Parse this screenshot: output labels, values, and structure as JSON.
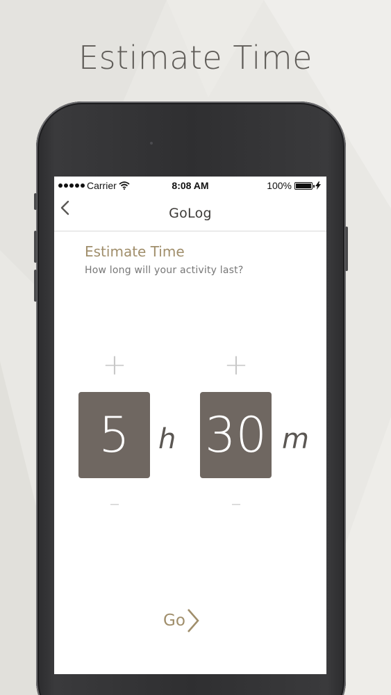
{
  "headline": "Estimate Time",
  "status_bar": {
    "carrier": "Carrier",
    "time": "8:08 AM",
    "battery": "100%",
    "signal_icon": "signal-dots-icon",
    "wifi_icon": "wifi-icon",
    "battery_icon": "battery-icon",
    "charging_icon": "bolt-icon"
  },
  "nav": {
    "title": "GoLog",
    "back_icon": "chevron-left-icon"
  },
  "content": {
    "title": "Estimate Time",
    "subtitle": "How long will your activity last?"
  },
  "hours": {
    "value": "5",
    "unit": "h",
    "increment_label": "+",
    "decrement_label": "–"
  },
  "minutes": {
    "value": "30",
    "unit": "m",
    "increment_label": "+",
    "decrement_label": "–"
  },
  "go_button": {
    "label": "Go",
    "icon": "chevron-right-icon"
  },
  "colors": {
    "accent": "#a08e6b",
    "box": "#6f6761",
    "background": "#e9e8e4"
  }
}
